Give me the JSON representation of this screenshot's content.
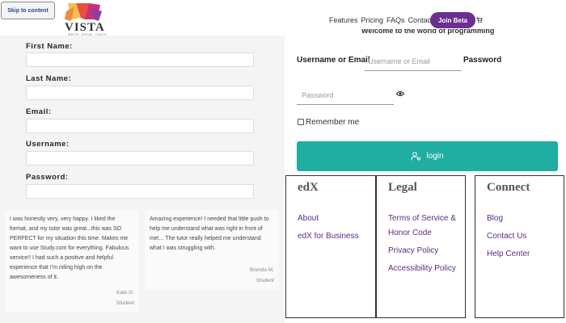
{
  "skip_link": "Skip to content",
  "brand": {
    "name": "VISTA",
    "tagline": "WRITE. SPEAK. TEACH."
  },
  "nav": {
    "items": [
      "Features",
      "Pricing",
      "FAQs",
      "Contact"
    ],
    "join_label": "Join Beta",
    "cart_icon": "cart-icon"
  },
  "signup": {
    "fields": [
      {
        "label": "First Name:",
        "value": ""
      },
      {
        "label": "Last Name:",
        "value": ""
      },
      {
        "label": "Email:",
        "value": ""
      },
      {
        "label": "Username:",
        "value": ""
      },
      {
        "label": "Password:",
        "value": ""
      }
    ]
  },
  "testimonials": [
    {
      "text": "I was honestly very, very happy. I liked the format, and my tutor was great...this was SO PERFECT for my situation this time. Makes me want to use Study.com for everything. Fabulous service!! I had such a positive and helpful experience that I'm riding high on the awesomeness of it.",
      "author": "Kate G.",
      "role": "Student"
    },
    {
      "text": "Amazing experience! I needed that little push to help me understand what was right in front of me!... The tutor really helped me understand what I was struggling with.",
      "author": "Brenda M.",
      "role": "Student"
    }
  ],
  "login": {
    "welcome": "Welcome to the world of programming",
    "username_label": "Username or Email",
    "username_placeholder": "Username or Email",
    "password_label": "Password",
    "password_placeholder": "Password",
    "remember_label": "Remember me",
    "login_label": "login",
    "accent_color": "#20aea2"
  },
  "footer": {
    "columns": [
      {
        "title": "edX",
        "links": [
          "About",
          "edX for Business"
        ]
      },
      {
        "title": "Legal",
        "links": [
          "Terms of Service &",
          "Honor Code",
          "Privacy Policy",
          "Accessibility Policy"
        ]
      },
      {
        "title": "Connect",
        "links": [
          "Blog",
          "Contact Us",
          "Help Center"
        ]
      }
    ]
  }
}
